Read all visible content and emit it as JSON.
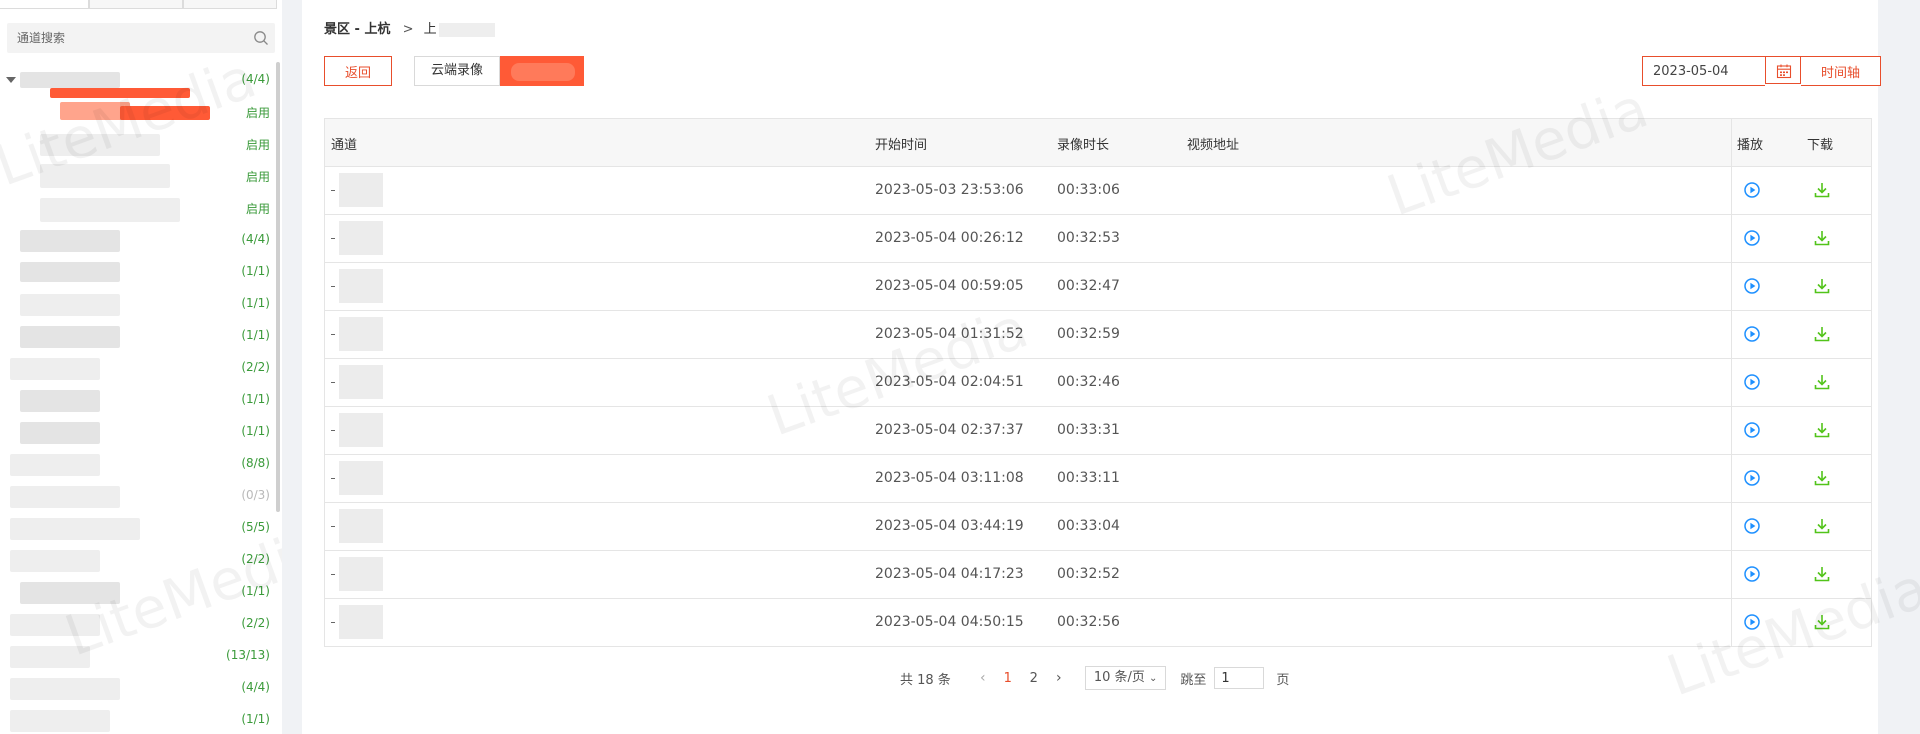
{
  "sidebar": {
    "search_placeholder": "通道搜索",
    "rows": [
      {
        "count": "(4/4)",
        "kind": "count"
      },
      {
        "count": "启用",
        "kind": "status"
      },
      {
        "count": "启用",
        "kind": "status"
      },
      {
        "count": "启用",
        "kind": "status"
      },
      {
        "count": "启用",
        "kind": "status"
      },
      {
        "count": "(4/4)",
        "kind": "count"
      },
      {
        "count": "(1/1)",
        "kind": "count"
      },
      {
        "count": "(1/1)",
        "kind": "count"
      },
      {
        "count": "(1/1)",
        "kind": "count"
      },
      {
        "count": "(2/2)",
        "kind": "count"
      },
      {
        "count": "(1/1)",
        "kind": "count"
      },
      {
        "count": "(1/1)",
        "kind": "count"
      },
      {
        "count": "(8/8)",
        "kind": "count"
      },
      {
        "count": "(0/3)",
        "kind": "dim"
      },
      {
        "count": "(5/5)",
        "kind": "count"
      },
      {
        "count": "(2/2)",
        "kind": "count"
      },
      {
        "count": "(1/1)",
        "kind": "count"
      },
      {
        "count": "(2/2)",
        "kind": "count"
      },
      {
        "count": "(13/13)",
        "kind": "count"
      },
      {
        "count": "(4/4)",
        "kind": "count"
      },
      {
        "count": "(1/1)",
        "kind": "count"
      }
    ]
  },
  "breadcrumb": {
    "root": "景区 - 上杭",
    "sep": ">",
    "current": "上"
  },
  "toolbar": {
    "back_label": "返回",
    "cloud_tab_label": "云端录像",
    "date_value": "2023-05-04",
    "timeline_label": "时间轴"
  },
  "table": {
    "headers": {
      "channel": "通道",
      "start_time": "开始时间",
      "duration": "录像时长",
      "video_url": "视频地址",
      "play": "播放",
      "download": "下载"
    },
    "rows": [
      {
        "start": "2023-05-03 23:53:06",
        "duration": "00:33:06"
      },
      {
        "start": "2023-05-04 00:26:12",
        "duration": "00:32:53"
      },
      {
        "start": "2023-05-04 00:59:05",
        "duration": "00:32:47"
      },
      {
        "start": "2023-05-04 01:31:52",
        "duration": "00:32:59"
      },
      {
        "start": "2023-05-04 02:04:51",
        "duration": "00:32:46"
      },
      {
        "start": "2023-05-04 02:37:37",
        "duration": "00:33:31"
      },
      {
        "start": "2023-05-04 03:11:08",
        "duration": "00:33:11"
      },
      {
        "start": "2023-05-04 03:44:19",
        "duration": "00:33:04"
      },
      {
        "start": "2023-05-04 04:17:23",
        "duration": "00:32:52"
      },
      {
        "start": "2023-05-04 04:50:15",
        "duration": "00:32:56"
      }
    ]
  },
  "pagination": {
    "total": "共 18 条",
    "prev": "‹",
    "pages": [
      "1",
      "2"
    ],
    "next": "›",
    "page_size": "10 条/页",
    "jump_label": "跳至",
    "jump_value": "1",
    "page_suffix": "页"
  },
  "watermark": "LiteMedia",
  "colors": {
    "accent": "#e84e2c",
    "active_tab": "#ff5a36",
    "status_green": "#3a9a3a",
    "play_blue": "#1e90ff",
    "download_green": "#52c41a"
  },
  "icons": {
    "search": "search-icon",
    "calendar": "calendar-icon",
    "play": "play-circle-icon",
    "download": "download-icon",
    "caret": "caret-down-icon"
  }
}
